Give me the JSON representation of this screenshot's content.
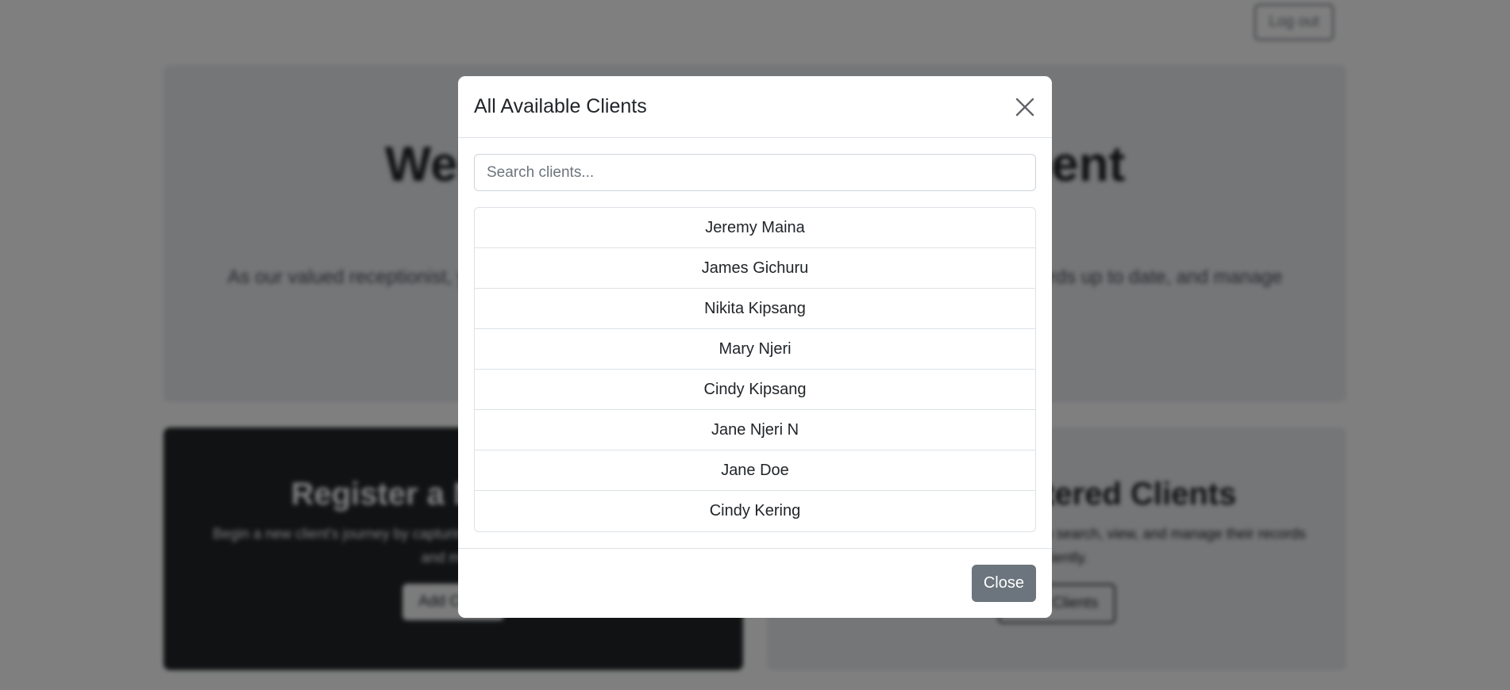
{
  "background": {
    "logout_label": "Log out",
    "hero": {
      "title": "Welcome to Client Management",
      "description": "As our valued receptionist, you play a vital role. Here you can register new clients, keep their records up to date, and manage every client who walks through our doors."
    },
    "register_card": {
      "title": "Register a New Client",
      "description": "Begin a new client's journey by capturing their full name, contact information and more.",
      "button_label": "Add Client"
    },
    "clients_card": {
      "title": "View Registered Clients",
      "description": "See a list of all current clients. You can search, view, and manage their records efficiently.",
      "button_label": "View Clients"
    }
  },
  "modal": {
    "title": "All Available Clients",
    "close_icon": "close-icon",
    "search": {
      "placeholder": "Search clients...",
      "value": ""
    },
    "clients": [
      "Jeremy Maina",
      "James Gichuru",
      "Nikita Kipsang",
      "Mary Njeri",
      "Cindy Kipsang",
      "Jane Njeri N",
      "Jane Doe",
      "Cindy Kering"
    ],
    "close_button_label": "Close"
  },
  "colors": {
    "secondary": "#6c757d",
    "dark": "#212529",
    "light": "#e9ecef",
    "border": "#dee2e6"
  }
}
